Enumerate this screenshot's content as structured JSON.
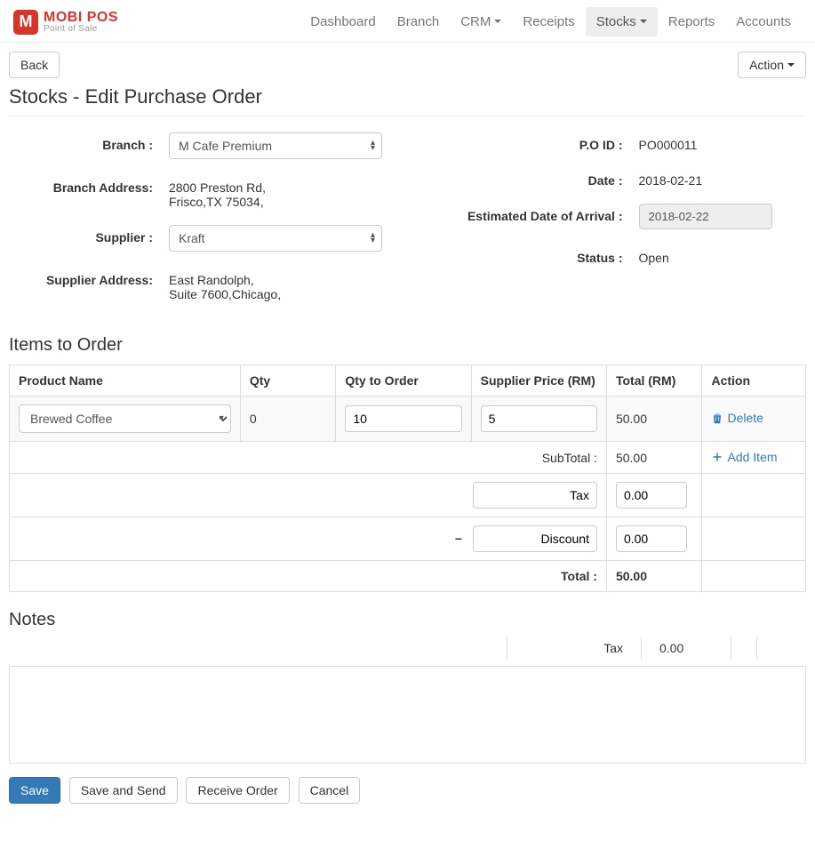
{
  "brand": {
    "main": "MOBI POS",
    "sub": "Point of Sale",
    "badge": "M"
  },
  "nav": {
    "items": [
      "Dashboard",
      "Branch",
      "CRM",
      "Receipts",
      "Stocks",
      "Reports",
      "Accounts"
    ],
    "active": "Stocks"
  },
  "buttons": {
    "back": "Back",
    "action": "Action",
    "save": "Save",
    "save_send": "Save and Send",
    "receive": "Receive Order",
    "cancel": "Cancel",
    "delete": "Delete",
    "add_item": "Add Item"
  },
  "page_title": "Stocks - Edit Purchase Order",
  "labels": {
    "branch": "Branch :",
    "branch_address": "Branch Address:",
    "supplier": "Supplier :",
    "supplier_address": "Supplier Address:",
    "po_id": "P.O ID :",
    "date": "Date :",
    "eta": "Estimated Date of Arrival :",
    "status": "Status :",
    "items_section": "Items to Order",
    "notes_section": "Notes"
  },
  "values": {
    "branch": "M Cafe Premium",
    "branch_address_l1": "2800 Preston Rd,",
    "branch_address_l2": "Frisco,TX 75034,",
    "supplier": "Kraft",
    "supplier_address_l1": "East Randolph,",
    "supplier_address_l2": "Suite 7600,Chicago,",
    "po_id": "PO000011",
    "date": "2018-02-21",
    "eta": "2018-02-22",
    "status": "Open"
  },
  "table": {
    "headers": {
      "product": "Product Name",
      "qty": "Qty",
      "qty_order": "Qty to Order",
      "supplier_price": "Supplier Price (RM)",
      "total": "Total (RM)",
      "action": "Action"
    },
    "rows": [
      {
        "product": "Brewed Coffee",
        "qty": "0",
        "qty_order": "10",
        "supplier_price": "5",
        "total": "50.00"
      }
    ],
    "summary": {
      "subtotal_label": "SubTotal :",
      "subtotal": "50.00",
      "tax_label": "Tax",
      "tax": "0.00",
      "discount_label": "Discount",
      "discount": "0.00",
      "minus": "−",
      "total_label": "Total :",
      "total": "50.00"
    }
  },
  "ghost": {
    "tax_label": "Tax",
    "tax_value": "0.00"
  }
}
